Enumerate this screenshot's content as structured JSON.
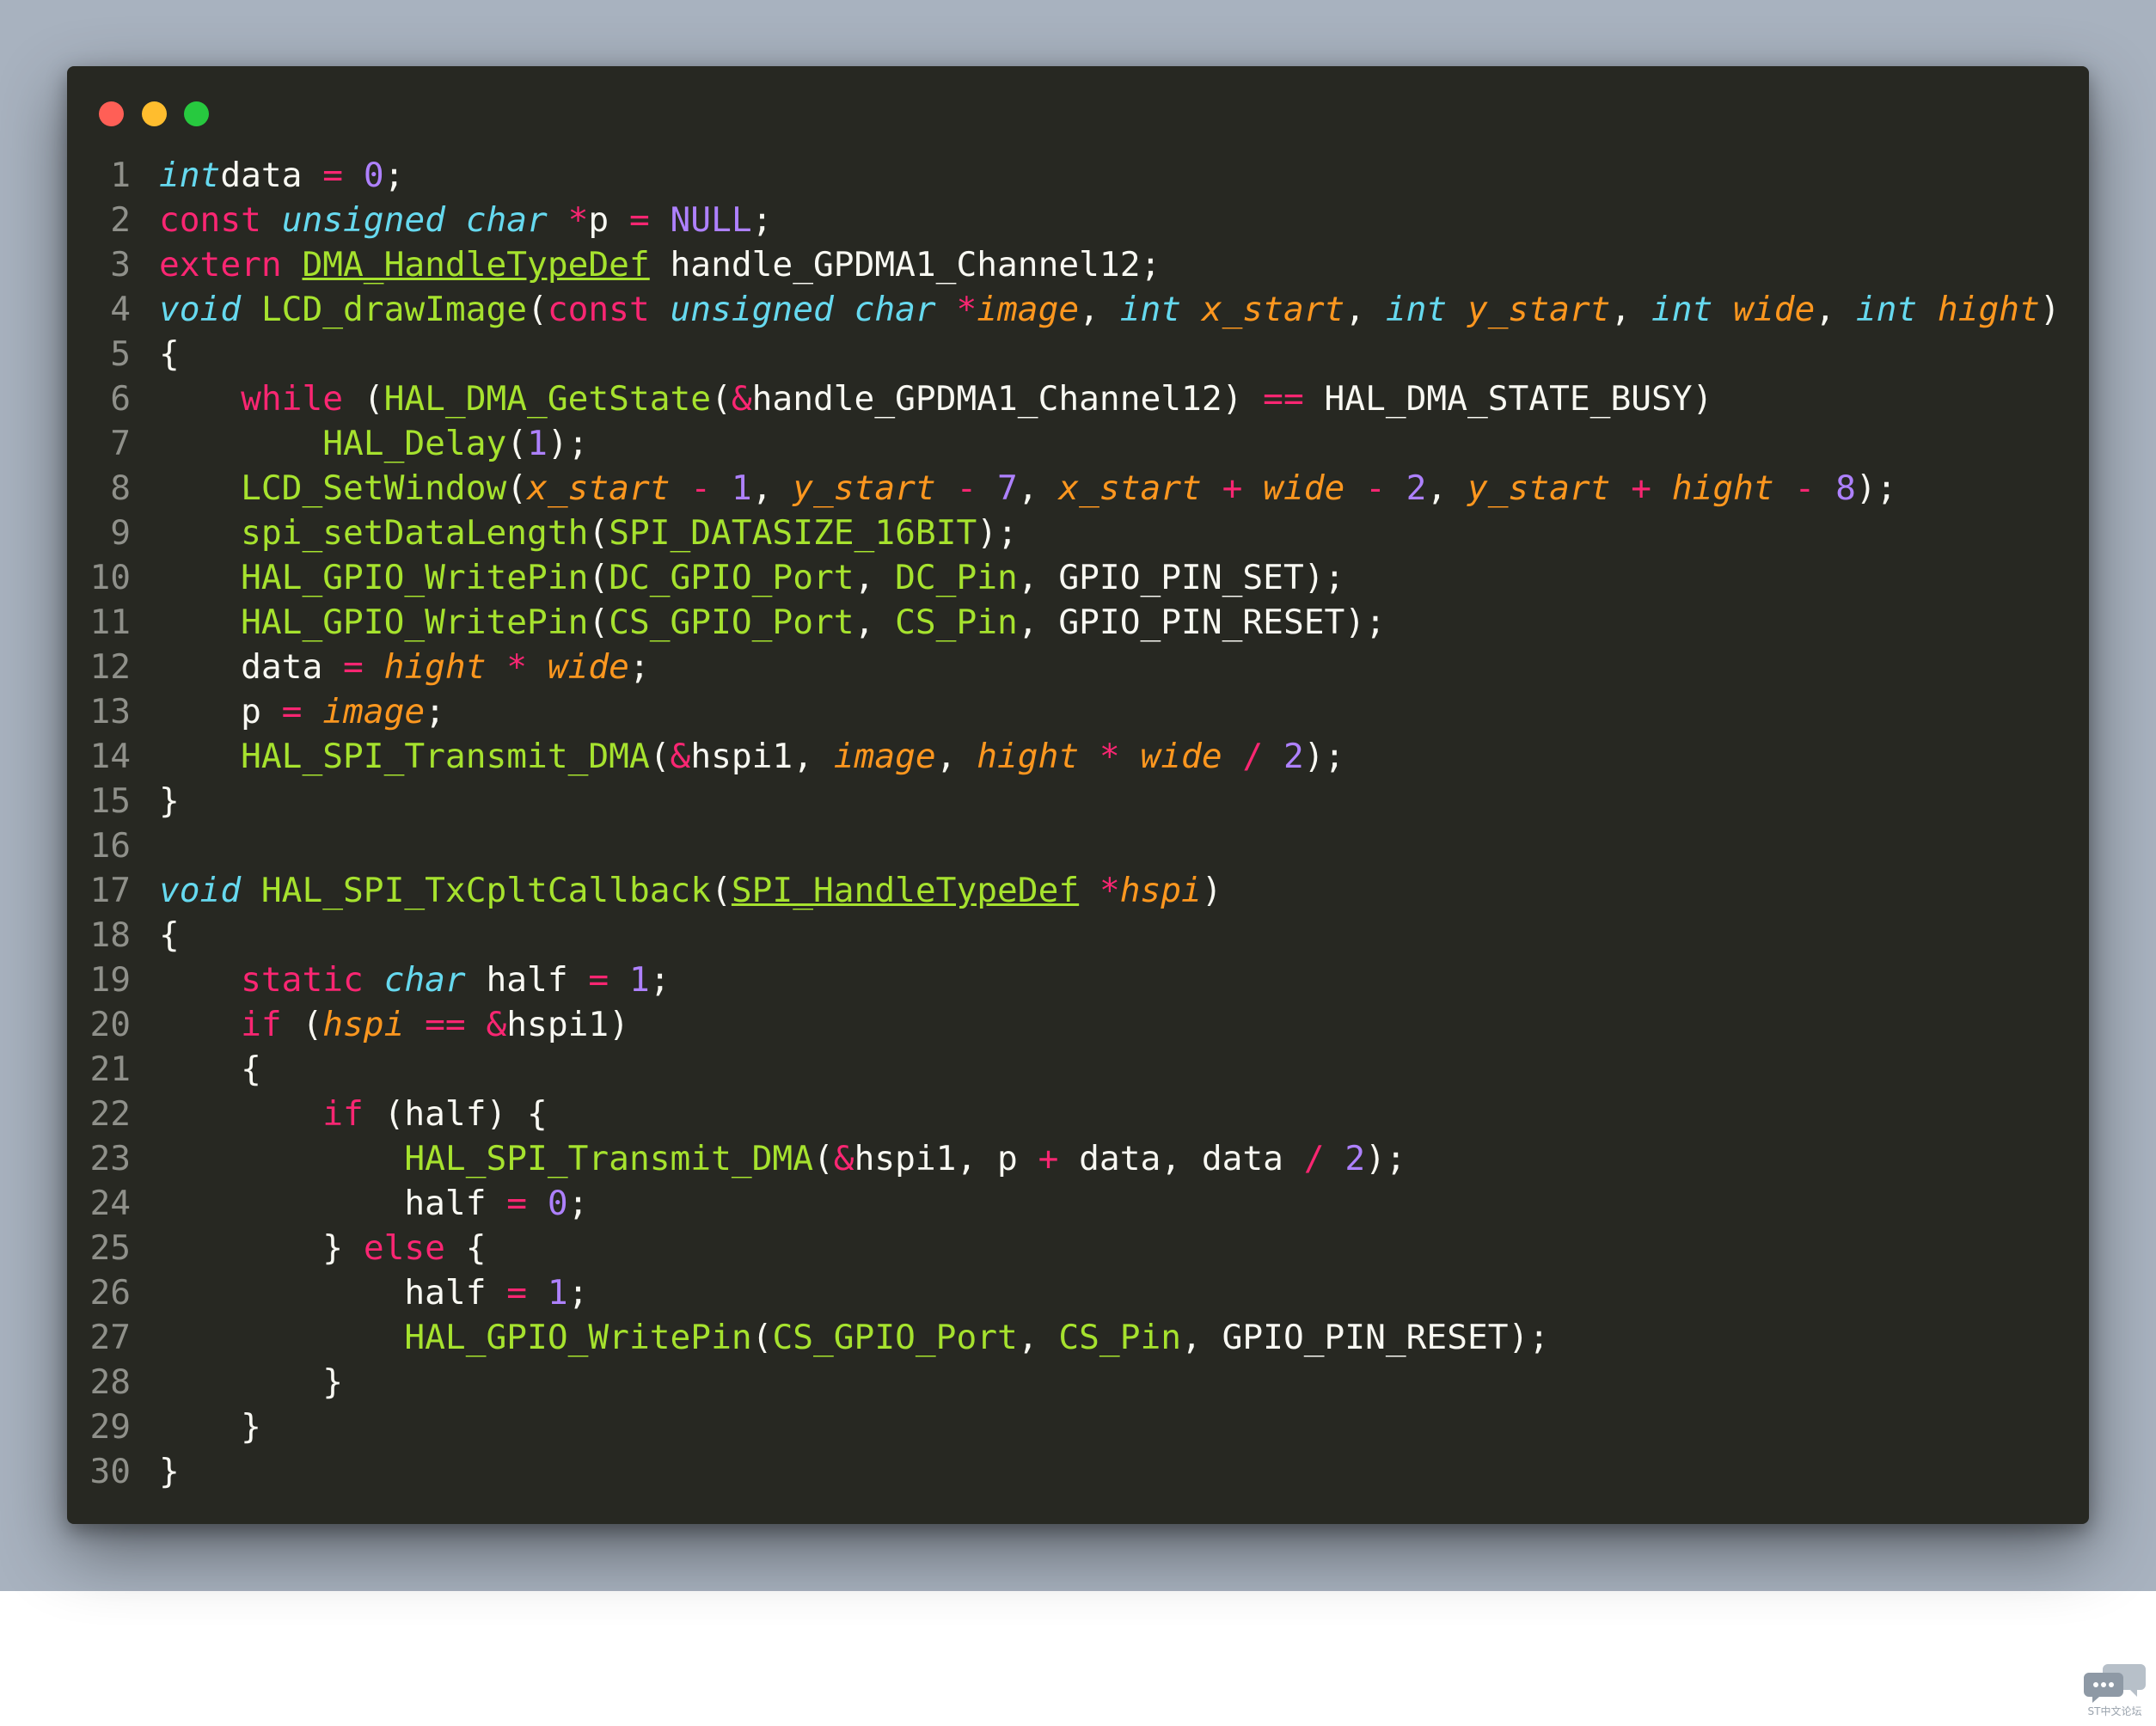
{
  "window_controls": [
    "close",
    "minimize",
    "maximize"
  ],
  "colors": {
    "backdrop": "#a8b2bf",
    "editor_bg": "#272822",
    "keyword": "#f92672",
    "type": "#66d9ef",
    "function": "#a6e22e",
    "number": "#ae81ff",
    "parameter": "#fd971f",
    "text": "#f8f8f2",
    "line_number": "#8f908a"
  },
  "code_lines": [
    {
      "n": "1",
      "t": [
        [
          "ty",
          "int"
        ],
        [
          "",
          "data"
        ],
        [
          "op",
          " = "
        ],
        [
          "num",
          "0"
        ],
        [
          "",
          ";"
        ]
      ]
    },
    {
      "n": "2",
      "t": [
        [
          "kw",
          "const"
        ],
        [
          "",
          " "
        ],
        [
          "ty",
          "unsigned"
        ],
        [
          "",
          " "
        ],
        [
          "ty",
          "char"
        ],
        [
          "",
          " "
        ],
        [
          "op",
          "*"
        ],
        [
          "",
          "p"
        ],
        [
          "op",
          " = "
        ],
        [
          "num",
          "NULL"
        ],
        [
          "",
          ";"
        ]
      ]
    },
    {
      "n": "3",
      "t": [
        [
          "kw",
          "extern"
        ],
        [
          "",
          " "
        ],
        [
          "cls",
          "DMA_HandleTypeDef"
        ],
        [
          "",
          " handle_GPDMA1_Channel12;"
        ]
      ]
    },
    {
      "n": "4",
      "t": [
        [
          "ty",
          "void"
        ],
        [
          "",
          " "
        ],
        [
          "fn",
          "LCD_drawImage"
        ],
        [
          "",
          "("
        ],
        [
          "kw",
          "const"
        ],
        [
          "",
          " "
        ],
        [
          "ty",
          "unsigned"
        ],
        [
          "",
          " "
        ],
        [
          "ty",
          "char"
        ],
        [
          "",
          " "
        ],
        [
          "op",
          "*"
        ],
        [
          "par",
          "image"
        ],
        [
          "",
          ", "
        ],
        [
          "ty",
          "int"
        ],
        [
          "",
          " "
        ],
        [
          "par",
          "x_start"
        ],
        [
          "",
          ", "
        ],
        [
          "ty",
          "int"
        ],
        [
          "",
          " "
        ],
        [
          "par",
          "y_start"
        ],
        [
          "",
          ", "
        ],
        [
          "ty",
          "int"
        ],
        [
          "",
          " "
        ],
        [
          "par",
          "wide"
        ],
        [
          "",
          ", "
        ],
        [
          "ty",
          "int"
        ],
        [
          "",
          " "
        ],
        [
          "par",
          "hight"
        ],
        [
          "",
          ")"
        ]
      ]
    },
    {
      "n": "5",
      "t": [
        [
          "",
          "{"
        ]
      ]
    },
    {
      "n": "6",
      "t": [
        [
          "",
          "    "
        ],
        [
          "kw",
          "while"
        ],
        [
          "",
          " ("
        ],
        [
          "fn",
          "HAL_DMA_GetState"
        ],
        [
          "",
          "("
        ],
        [
          "op",
          "&"
        ],
        [
          "",
          "handle_GPDMA1_Channel12)"
        ],
        [
          "op",
          " == "
        ],
        [
          "",
          "HAL_DMA_STATE_BUSY)"
        ]
      ]
    },
    {
      "n": "7",
      "t": [
        [
          "",
          "        "
        ],
        [
          "fn",
          "HAL_Delay"
        ],
        [
          "",
          "("
        ],
        [
          "num",
          "1"
        ],
        [
          "",
          ");"
        ]
      ]
    },
    {
      "n": "8",
      "t": [
        [
          "",
          "    "
        ],
        [
          "fn",
          "LCD_SetWindow"
        ],
        [
          "",
          "("
        ],
        [
          "par",
          "x_start"
        ],
        [
          "op",
          " - "
        ],
        [
          "num",
          "1"
        ],
        [
          "",
          ", "
        ],
        [
          "par",
          "y_start"
        ],
        [
          "op",
          " - "
        ],
        [
          "num",
          "7"
        ],
        [
          "",
          ", "
        ],
        [
          "par",
          "x_start"
        ],
        [
          "op",
          " + "
        ],
        [
          "par",
          "wide"
        ],
        [
          "op",
          " - "
        ],
        [
          "num",
          "2"
        ],
        [
          "",
          ", "
        ],
        [
          "par",
          "y_start"
        ],
        [
          "op",
          " + "
        ],
        [
          "par",
          "hight"
        ],
        [
          "op",
          " - "
        ],
        [
          "num",
          "8"
        ],
        [
          "",
          ");"
        ]
      ]
    },
    {
      "n": "9",
      "t": [
        [
          "",
          "    "
        ],
        [
          "fn",
          "spi_setDataLength"
        ],
        [
          "",
          "("
        ],
        [
          "fn",
          "SPI_DATASIZE_16BIT"
        ],
        [
          "",
          ");"
        ]
      ]
    },
    {
      "n": "10",
      "t": [
        [
          "",
          "    "
        ],
        [
          "fn",
          "HAL_GPIO_WritePin"
        ],
        [
          "",
          "("
        ],
        [
          "fn",
          "DC_GPIO_Port"
        ],
        [
          "",
          ", "
        ],
        [
          "fn",
          "DC_Pin"
        ],
        [
          "",
          ", GPIO_PIN_SET);"
        ]
      ]
    },
    {
      "n": "11",
      "t": [
        [
          "",
          "    "
        ],
        [
          "fn",
          "HAL_GPIO_WritePin"
        ],
        [
          "",
          "("
        ],
        [
          "fn",
          "CS_GPIO_Port"
        ],
        [
          "",
          ", "
        ],
        [
          "fn",
          "CS_Pin"
        ],
        [
          "",
          ", GPIO_PIN_RESET);"
        ]
      ]
    },
    {
      "n": "12",
      "t": [
        [
          "",
          "    data"
        ],
        [
          "op",
          " = "
        ],
        [
          "par",
          "hight"
        ],
        [
          "op",
          " * "
        ],
        [
          "par",
          "wide"
        ],
        [
          "",
          ";"
        ]
      ]
    },
    {
      "n": "13",
      "t": [
        [
          "",
          "    p"
        ],
        [
          "op",
          " = "
        ],
        [
          "par",
          "image"
        ],
        [
          "",
          ";"
        ]
      ]
    },
    {
      "n": "14",
      "t": [
        [
          "",
          "    "
        ],
        [
          "fn",
          "HAL_SPI_Transmit_DMA"
        ],
        [
          "",
          "("
        ],
        [
          "op",
          "&"
        ],
        [
          "",
          "hspi1, "
        ],
        [
          "par",
          "image"
        ],
        [
          "",
          ", "
        ],
        [
          "par",
          "hight"
        ],
        [
          "op",
          " * "
        ],
        [
          "par",
          "wide"
        ],
        [
          "op",
          " / "
        ],
        [
          "num",
          "2"
        ],
        [
          "",
          ");"
        ]
      ]
    },
    {
      "n": "15",
      "t": [
        [
          "",
          "}"
        ]
      ]
    },
    {
      "n": "16",
      "t": []
    },
    {
      "n": "17",
      "t": [
        [
          "ty",
          "void"
        ],
        [
          "",
          " "
        ],
        [
          "fn",
          "HAL_SPI_TxCpltCallback"
        ],
        [
          "",
          "("
        ],
        [
          "cls",
          "SPI_HandleTypeDef"
        ],
        [
          "",
          " "
        ],
        [
          "op",
          "*"
        ],
        [
          "par",
          "hspi"
        ],
        [
          "",
          ")"
        ]
      ]
    },
    {
      "n": "18",
      "t": [
        [
          "",
          "{"
        ]
      ]
    },
    {
      "n": "19",
      "t": [
        [
          "",
          "    "
        ],
        [
          "kw",
          "static"
        ],
        [
          "",
          " "
        ],
        [
          "ty",
          "char"
        ],
        [
          "",
          " half"
        ],
        [
          "op",
          " = "
        ],
        [
          "num",
          "1"
        ],
        [
          "",
          ";"
        ]
      ]
    },
    {
      "n": "20",
      "t": [
        [
          "",
          "    "
        ],
        [
          "kw",
          "if"
        ],
        [
          "",
          " ("
        ],
        [
          "par",
          "hspi"
        ],
        [
          "op",
          " == "
        ],
        [
          "op",
          "&"
        ],
        [
          "",
          "hspi1)"
        ]
      ]
    },
    {
      "n": "21",
      "t": [
        [
          "",
          "    {"
        ]
      ]
    },
    {
      "n": "22",
      "t": [
        [
          "",
          "        "
        ],
        [
          "kw",
          "if"
        ],
        [
          "",
          " (half) {"
        ]
      ]
    },
    {
      "n": "23",
      "t": [
        [
          "",
          "            "
        ],
        [
          "fn",
          "HAL_SPI_Transmit_DMA"
        ],
        [
          "",
          "("
        ],
        [
          "op",
          "&"
        ],
        [
          "",
          "hspi1, p"
        ],
        [
          "op",
          " + "
        ],
        [
          "",
          "data, data"
        ],
        [
          "op",
          " / "
        ],
        [
          "num",
          "2"
        ],
        [
          "",
          ");"
        ]
      ]
    },
    {
      "n": "24",
      "t": [
        [
          "",
          "            half"
        ],
        [
          "op",
          " = "
        ],
        [
          "num",
          "0"
        ],
        [
          "",
          ";"
        ]
      ]
    },
    {
      "n": "25",
      "t": [
        [
          "",
          "        } "
        ],
        [
          "kw",
          "else"
        ],
        [
          "",
          " {"
        ]
      ]
    },
    {
      "n": "26",
      "t": [
        [
          "",
          "            half"
        ],
        [
          "op",
          " = "
        ],
        [
          "num",
          "1"
        ],
        [
          "",
          ";"
        ]
      ]
    },
    {
      "n": "27",
      "t": [
        [
          "",
          "            "
        ],
        [
          "fn",
          "HAL_GPIO_WritePin"
        ],
        [
          "",
          "("
        ],
        [
          "fn",
          "CS_GPIO_Port"
        ],
        [
          "",
          ", "
        ],
        [
          "fn",
          "CS_Pin"
        ],
        [
          "",
          ", GPIO_PIN_RESET);"
        ]
      ]
    },
    {
      "n": "28",
      "t": [
        [
          "",
          "        }"
        ]
      ]
    },
    {
      "n": "29",
      "t": [
        [
          "",
          "    }"
        ]
      ]
    },
    {
      "n": "30",
      "t": [
        [
          "",
          "}"
        ]
      ]
    }
  ],
  "watermark": {
    "icon": "chat-bubbles-icon",
    "text": "ST中文论坛"
  }
}
